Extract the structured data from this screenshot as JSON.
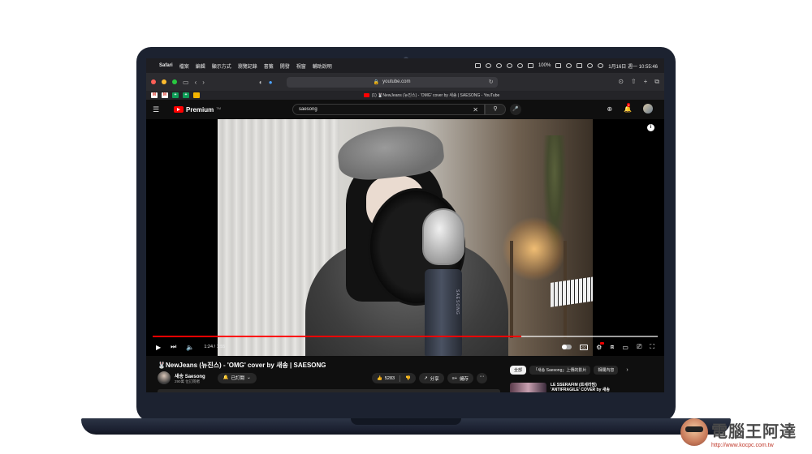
{
  "menubar": {
    "app": "Safari",
    "items": [
      "檔案",
      "編輯",
      "顯示方式",
      "瀏覽記錄",
      "書籤",
      "開發",
      "視窗",
      "輔助說明"
    ],
    "battery": "100%",
    "datetime": "1月16日 週一 10:55:46"
  },
  "safari": {
    "url": "youtube.com",
    "tab_title": "(1) 🐰NewJeans (뉴진스) - 'OMG' cover by 새송 | SAESONG - YouTube"
  },
  "youtube": {
    "logo": "Premium",
    "logo_tm": "TM",
    "search_value": "saesong",
    "notification_count": "1"
  },
  "player": {
    "mic_brand": "SAESONG",
    "time": "1:24 / 1:55",
    "progress": 0.73,
    "buffered": 1.0
  },
  "video": {
    "title": "🐰NewJeans (뉴진스) - 'OMG' cover by 새송 | SAESONG",
    "channel_name": "새송 Saesong",
    "channel_subs": "290萬 位訂閱者",
    "subscribe_label": "已訂閱",
    "likes": "5283",
    "share_label": "分享",
    "save_label": "儲存"
  },
  "chips": [
    "全部",
    "「새송 Saesong」上傳的影片",
    "相關內容"
  ],
  "recommendation": {
    "title_line1": "LE SSERAFIM (르세라핌)",
    "title_line2": "'ANTIFRAGILE' COVER by 새송"
  },
  "watermark": {
    "name": "電腦王阿達",
    "url": "http://www.kocpc.com.tw"
  },
  "colors": {
    "yt_red": "#ff0000",
    "laptop": "#1c2230"
  }
}
